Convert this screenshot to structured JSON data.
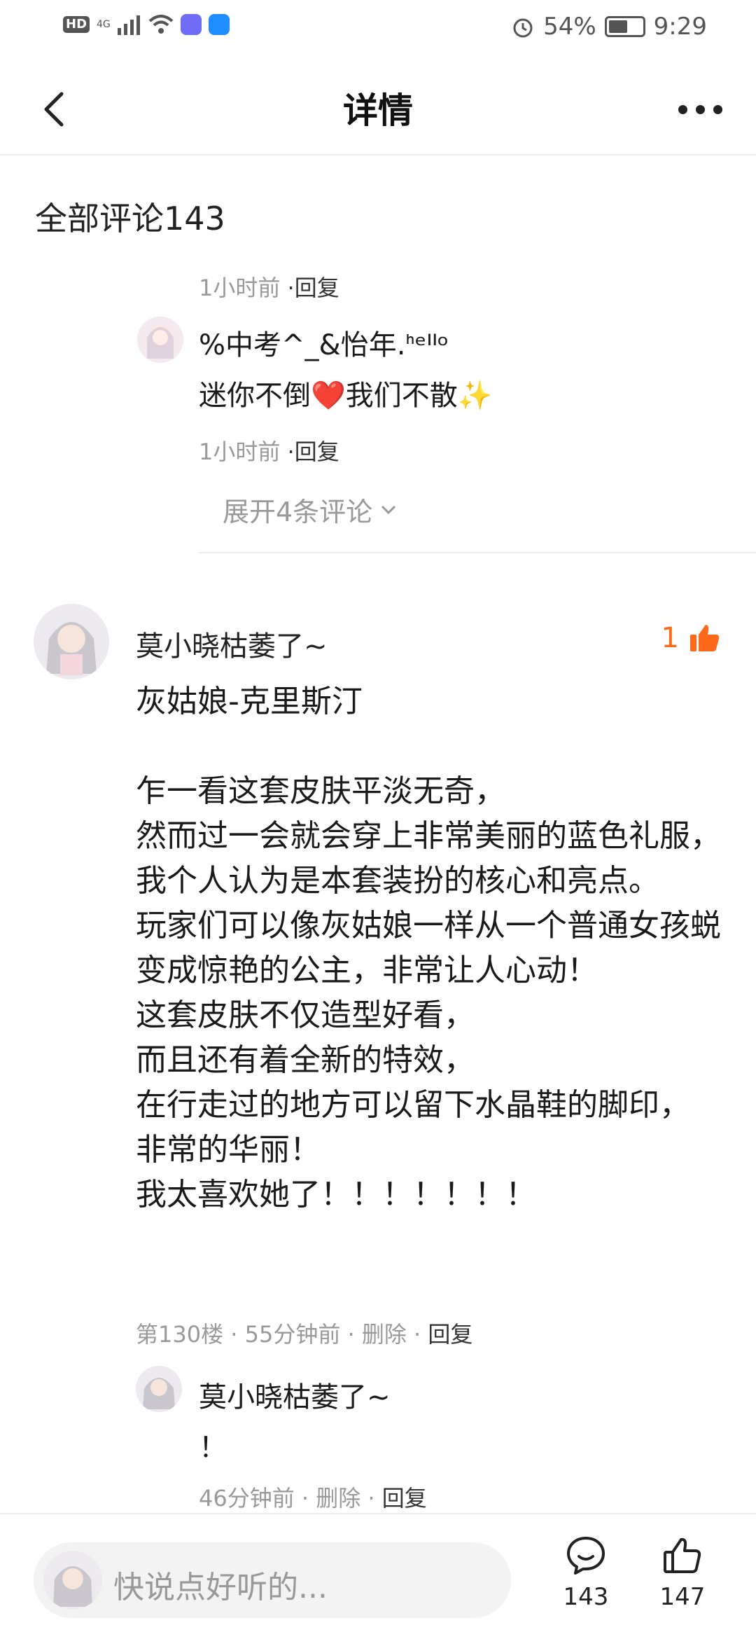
{
  "status_bar": {
    "left_badge": "HD",
    "signal_label": "4G",
    "battery": "54%",
    "time": "9:29"
  },
  "header": {
    "title": "详情"
  },
  "comments_section": {
    "title": "全部评论143"
  },
  "prev_comment": {
    "meta_time": "1小时前",
    "meta_reply": "·回复",
    "nested": {
      "name": "%中考^_&怡年.ᑋᵉᑊᑊᵒ",
      "text": "迷你不倒❤️我们不散✨",
      "meta_time": "1小时前",
      "meta_reply": "·回复"
    },
    "expand_label": "展开4条评论"
  },
  "main_comment": {
    "name": "莫小晓枯萎了~",
    "likes": "1",
    "body": "灰姑娘-克里斯汀\n\n乍一看这套皮肤平淡无奇，\n然而过一会就会穿上非常美丽的蓝色礼服，我个人认为是本套装扮的核心和亮点。\n玩家们可以像灰姑娘一样从一个普通女孩蜕变成惊艳的公主，非常让人心动！\n这套皮肤不仅造型好看，\n而且还有着全新的特效，\n在行走过的地方可以留下水晶鞋的脚印，\n非常的华丽！\n我太喜欢她了！！！！！！！",
    "floor": "第130楼",
    "time": "55分钟前",
    "delete": "删除",
    "reply": "回复",
    "replies": [
      {
        "name": "莫小晓枯萎了~",
        "text": "！",
        "time": "46分钟前",
        "delete": "删除",
        "reply": "回复"
      }
    ]
  },
  "bottom_bar": {
    "input_placeholder": "快说点好听的...",
    "comment_count": "143",
    "like_count": "147"
  },
  "colors": {
    "accent_orange": "#ff6a1a",
    "muted_text": "#999999"
  }
}
